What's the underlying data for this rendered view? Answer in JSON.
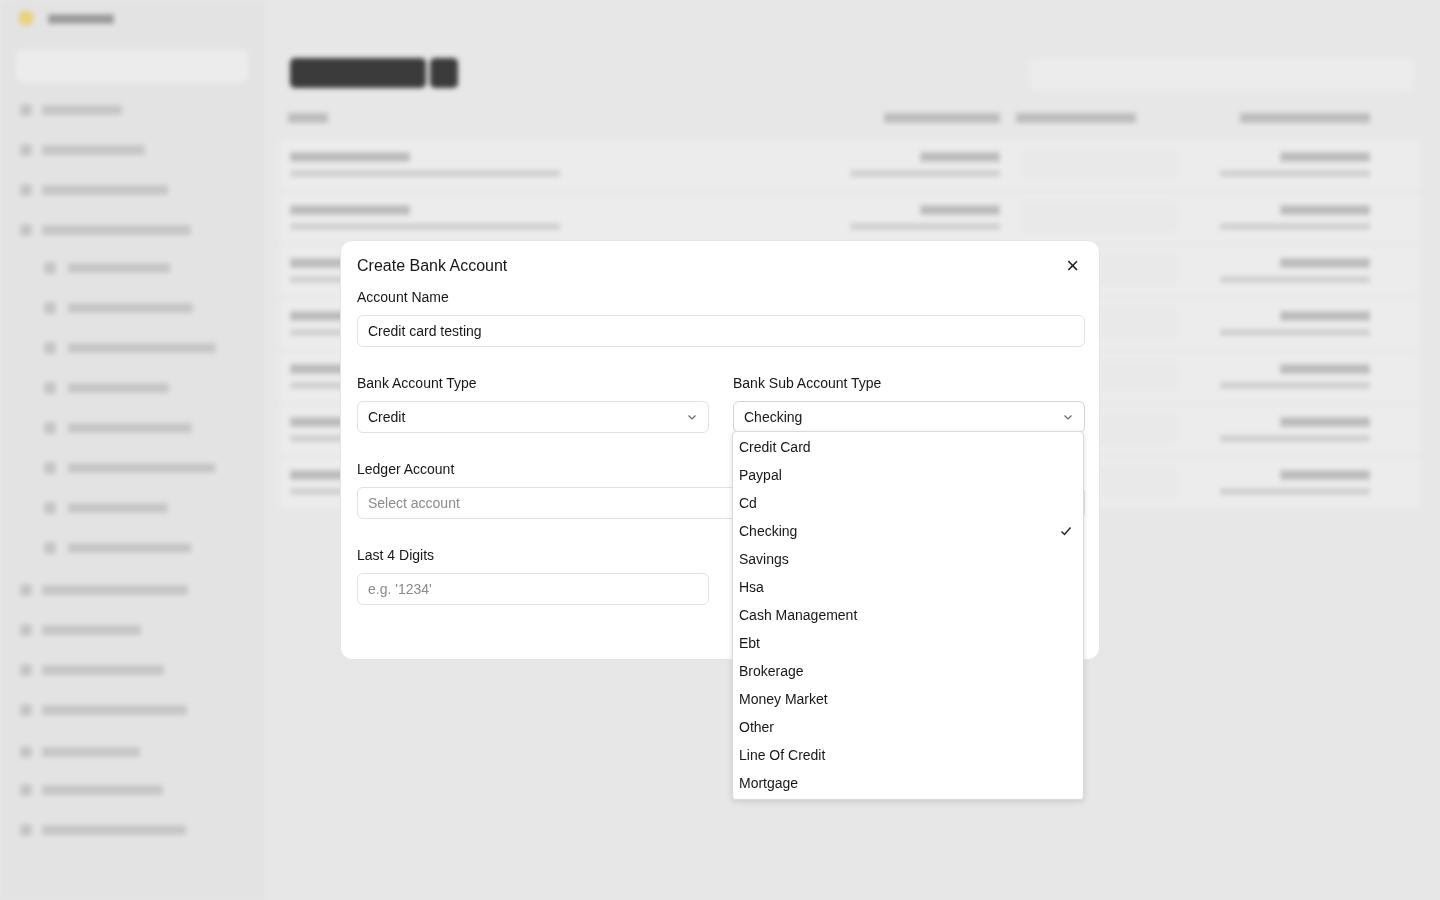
{
  "dialog": {
    "title": "Create Bank Account",
    "close": "×",
    "fields": [
      {
        "label": "Account Name",
        "kind": "text",
        "value": "Credit card testing"
      },
      {
        "label": "Bank Account Type",
        "kind": "select",
        "value": "Credit",
        "open": false
      },
      {
        "label": "Bank Sub Account Type",
        "kind": "select",
        "value": "Checking",
        "open": true
      },
      {
        "label": "Ledger Account",
        "kind": "picker",
        "placeholder": "Select account"
      },
      {
        "label": "Last 4 Digits",
        "kind": "text",
        "placeholder": "e.g. '1234'"
      }
    ]
  },
  "dropdown": {
    "options": [
      {
        "label": "Credit Card",
        "selected": false
      },
      {
        "label": "Paypal",
        "selected": false
      },
      {
        "label": "Cd",
        "selected": false
      },
      {
        "label": "Checking",
        "selected": true
      },
      {
        "label": "Savings",
        "selected": false
      },
      {
        "label": "Hsa",
        "selected": false
      },
      {
        "label": "Cash Management",
        "selected": false
      },
      {
        "label": "Ebt",
        "selected": false
      },
      {
        "label": "Brokerage",
        "selected": false
      },
      {
        "label": "Money Market",
        "selected": false
      },
      {
        "label": "Other",
        "selected": false
      },
      {
        "label": "Line Of Credit",
        "selected": false
      },
      {
        "label": "Mortgage",
        "selected": false
      }
    ]
  }
}
